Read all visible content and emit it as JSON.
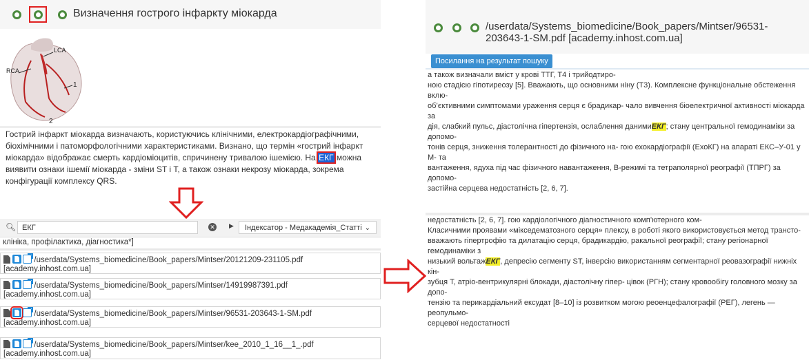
{
  "left": {
    "title": "Визначення гострого інфаркту міокарда",
    "outline_nodes": [
      {
        "id": "node-1",
        "selected": false
      },
      {
        "id": "node-2",
        "selected": true
      },
      {
        "id": "node-3",
        "selected": false
      }
    ],
    "heart_labels": {
      "lca": "LCA",
      "rca": "RCA",
      "n1": "1",
      "n2": "2"
    },
    "paragraph_before": "Гострий інфаркт міокарда визначають, користуючись клінічними, електрокардіографічними, біохімічними і патоморфологічними характеристиками. Визнано, що термін «гострий інфаркт міокарда» відображає смерть кардіоміоцитів, спричинену тривалою ішемією. На",
    "highlight_term": "ЕКГ",
    "paragraph_after": "можна виявити ознаки ішемії міокарда - зміни ST і T, а також ознаки некрозу міокарда, зокрема конфігурації комплексу QRS."
  },
  "search": {
    "query": "ЕКГ",
    "indexer_selected": "Індексатор - Медакадемія_Статті",
    "previous_tail": "клініка, профілактика, діагностика*]",
    "results": [
      {
        "path": "/userdata/Systems_biomedicine/Book_papers/Mintser/20121209-231105.pdf",
        "source": "[academy.inhost.com.ua]",
        "highlighted": false
      },
      {
        "path": "/userdata/Systems_biomedicine/Book_papers/Mintser/14919987391.pdf",
        "source": "[academy.inhost.com.ua]",
        "highlighted": false
      },
      {
        "path": "/userdata/Systems_biomedicine/Book_papers/Mintser/96531-203643-1-SM.pdf",
        "source": "[academy.inhost.com.ua]",
        "highlighted": true
      },
      {
        "path": "/userdata/Systems_biomedicine/Book_papers/Mintser/kee_2010_1_16__1_.pdf",
        "source": "[academy.inhost.com.ua]",
        "highlighted": false
      }
    ]
  },
  "right": {
    "title_line1": "/userdata/Systems_biomedicine/Book_papers/Mintser/96531-",
    "title_line2": "203643-1-SM.pdf [academy.inhost.com.ua]",
    "result_link_label": "Посилання на результат пошуку",
    "block1": [
      "а також визначали вміст у крові ТТГ, Т4 і трийодтиро-",
      "  ною стадією гіпотиреозу [5]. Вважають, що основними ніну (Т3). Комплексне функціональне обстеження вклю-",
      "  об’єктивними симптомами ураження серця є брадикар- чало вивчення біоелектричної активності міокарда за",
      "  дія, слабкий пульс, діастолічна гіпертензія, ослаблення даними|ЕКГ|; стану центральної гемодинаміки за допомо-",
      "  тонів серця, зниження толерантності до фізичного на- гою ехокардіографії (ЕхоКГ) на апараті ЕКС–У-01 у М- та",
      "  вантаження, ядуха під час фізичного навантаження, В-режимі та тетраполярної реографії (ТПРГ) за допомо-",
      "  застійна серцева недостатність [2, 6, 7]."
    ],
    "block2": [
      "недостатність [2, 6, 7]. гою кардіологічного діагностичного комп’ютерного ком-",
      "  Класичними проявами «мікседематозного серця» плексу, в роботі якого використовується метод трансто-",
      "  вважають гіпертрофію та дилатацію серця, брадикардію, ракальної реографії; стану регіонарної гемодинаміки з",
      "  низький вольтаж|ЕКГ|, депресію сегменту ST, інверсію використанням сегментарної реовазографії нижніх кін-",
      "  зубця Т, атріо-вентрикулярні блокади, діастолічну гіпер- цівок (РГН); стану кровообігу головного мозку за допо-",
      "  тензію та перикардіальний ексудат [8–10] із розвитком могою реоенцефалографії (РЕГ), легень — реопульмо-",
      "  серцевої недостатності"
    ]
  },
  "colors": {
    "node": "#4a8a3c",
    "red": "#e02020",
    "blue": "#3a8fd1",
    "highlight": "#f4f02a"
  }
}
